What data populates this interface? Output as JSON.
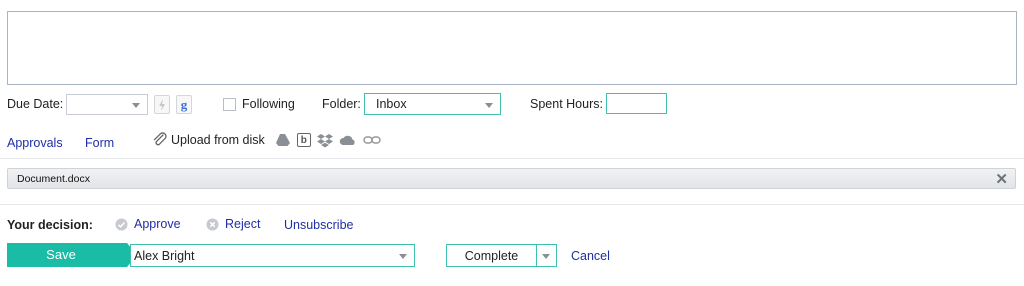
{
  "form": {
    "due_date_label": "Due Date:",
    "due_date_value": "",
    "following_label": "Following",
    "following_checked": false,
    "folder_label": "Folder:",
    "folder_value": "Inbox",
    "spent_hours_label": "Spent Hours:",
    "spent_hours_value": ""
  },
  "tabs": [
    {
      "label": "Approvals"
    },
    {
      "label": "Form"
    }
  ],
  "upload": {
    "label": "Upload from disk",
    "sources": [
      "google-drive-icon",
      "box-icon",
      "dropbox-icon",
      "onedrive-icon",
      "link-icon"
    ]
  },
  "attachment": {
    "name": "Document.docx",
    "remove_icon": "close-icon"
  },
  "decision": {
    "label": "Your decision:",
    "approve_label": "Approve",
    "reject_label": "Reject",
    "unsubscribe_label": "Unsubscribe"
  },
  "footer": {
    "save_label": "Save",
    "assignee_value": "Alex Bright",
    "complete_label": "Complete",
    "cancel_label": "Cancel"
  },
  "colors": {
    "accent": "#1bbca6",
    "link": "#1f2ea8",
    "field_border": "#3fbfae"
  }
}
